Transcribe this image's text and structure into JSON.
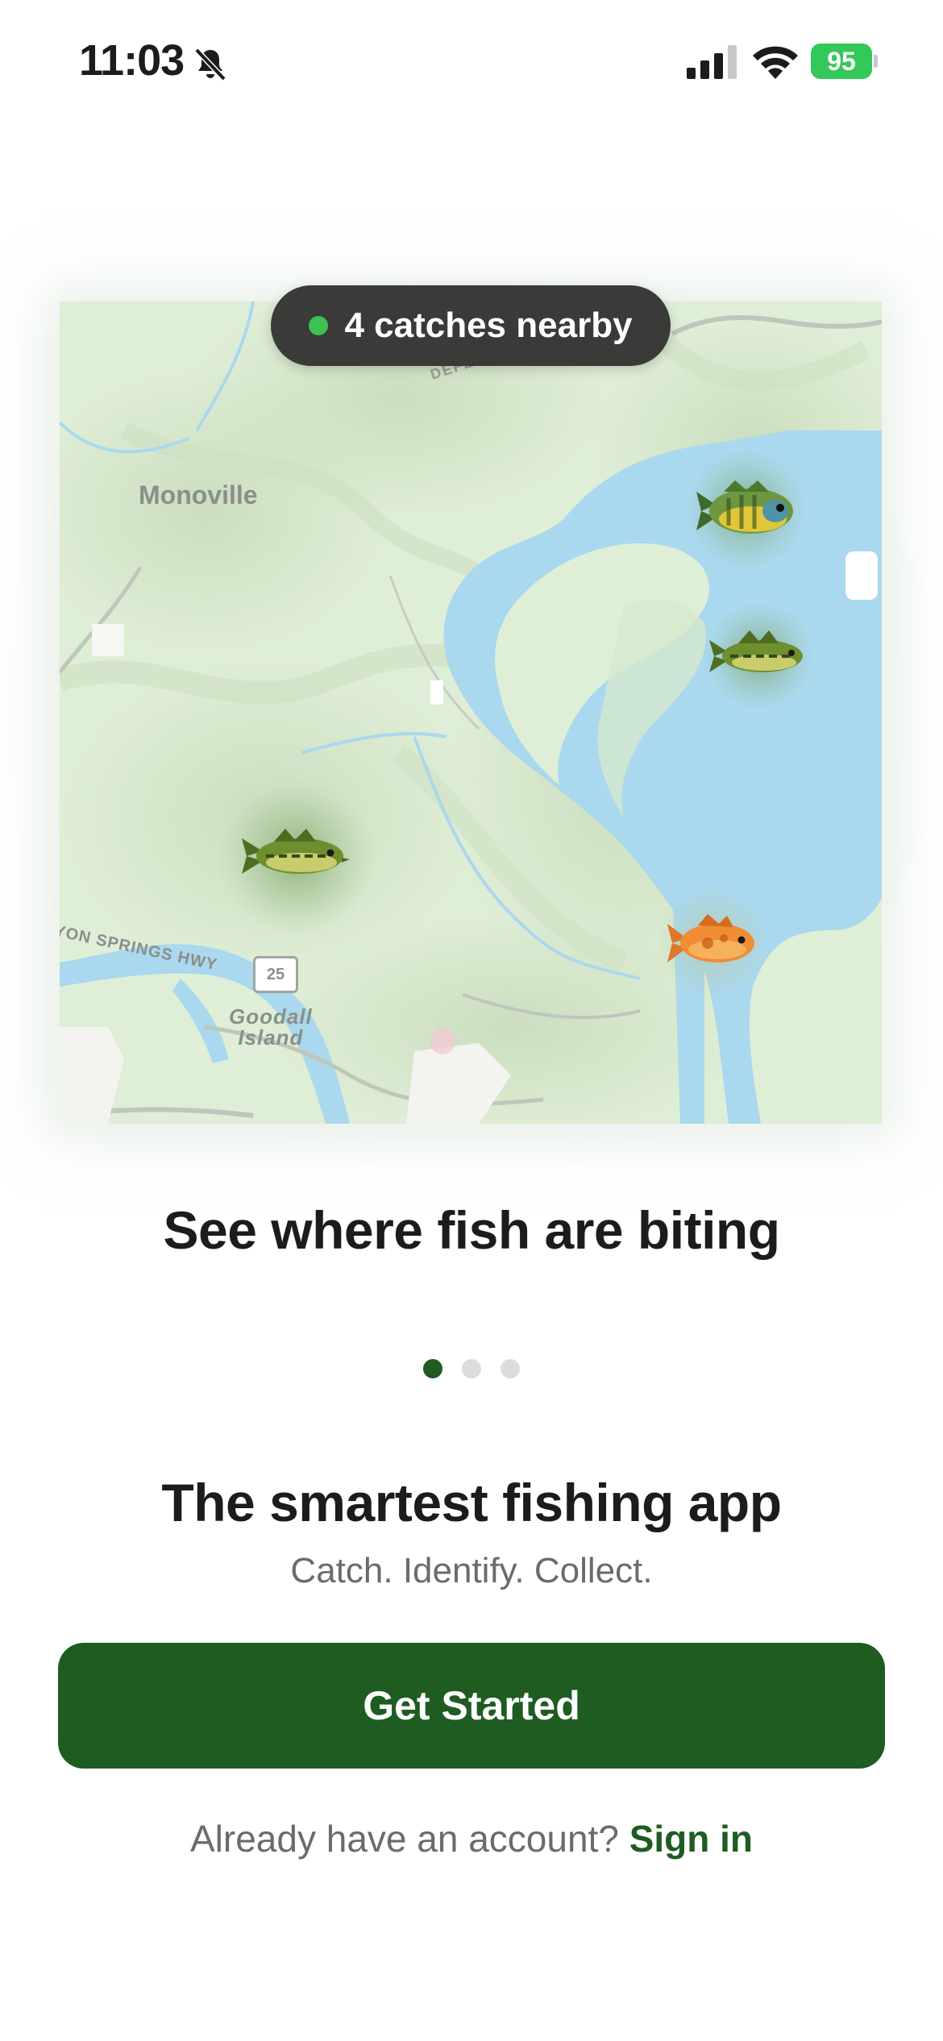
{
  "status_bar": {
    "time": "11:03",
    "battery_level": "95",
    "icons": [
      "bell-slash-icon",
      "cellular-signal-icon",
      "wifi-icon",
      "battery-charging-icon"
    ]
  },
  "map": {
    "badge": {
      "text": "4 catches nearby",
      "dot_color": "#3cc152"
    },
    "labels": {
      "town": "Monoville",
      "road": "YON SPRINGS HWY",
      "route_shield": "25",
      "island_line1": "Goodall",
      "island_line2": "Island",
      "street_fragment": "DEFEATED"
    },
    "markers": [
      {
        "name": "bluegill-marker",
        "icon": "bluegill-fish-icon"
      },
      {
        "name": "bass-marker-east",
        "icon": "bass-fish-icon"
      },
      {
        "name": "bass-marker-west",
        "icon": "bass-fish-icon"
      },
      {
        "name": "goldfish-marker",
        "icon": "orange-fish-icon"
      }
    ]
  },
  "carousel": {
    "slide_title": "See where fish are biting",
    "page_count": 3,
    "active_page": 1
  },
  "onboarding": {
    "headline": "The smartest fishing app",
    "tagline": "Catch. Identify. Collect.",
    "cta_label": "Get Started",
    "signin_prompt": "Already have an account?",
    "signin_link": "Sign in"
  },
  "colors": {
    "brand_green": "#1e5c22",
    "water": "#aad8ee",
    "land": "#dfeed6"
  }
}
